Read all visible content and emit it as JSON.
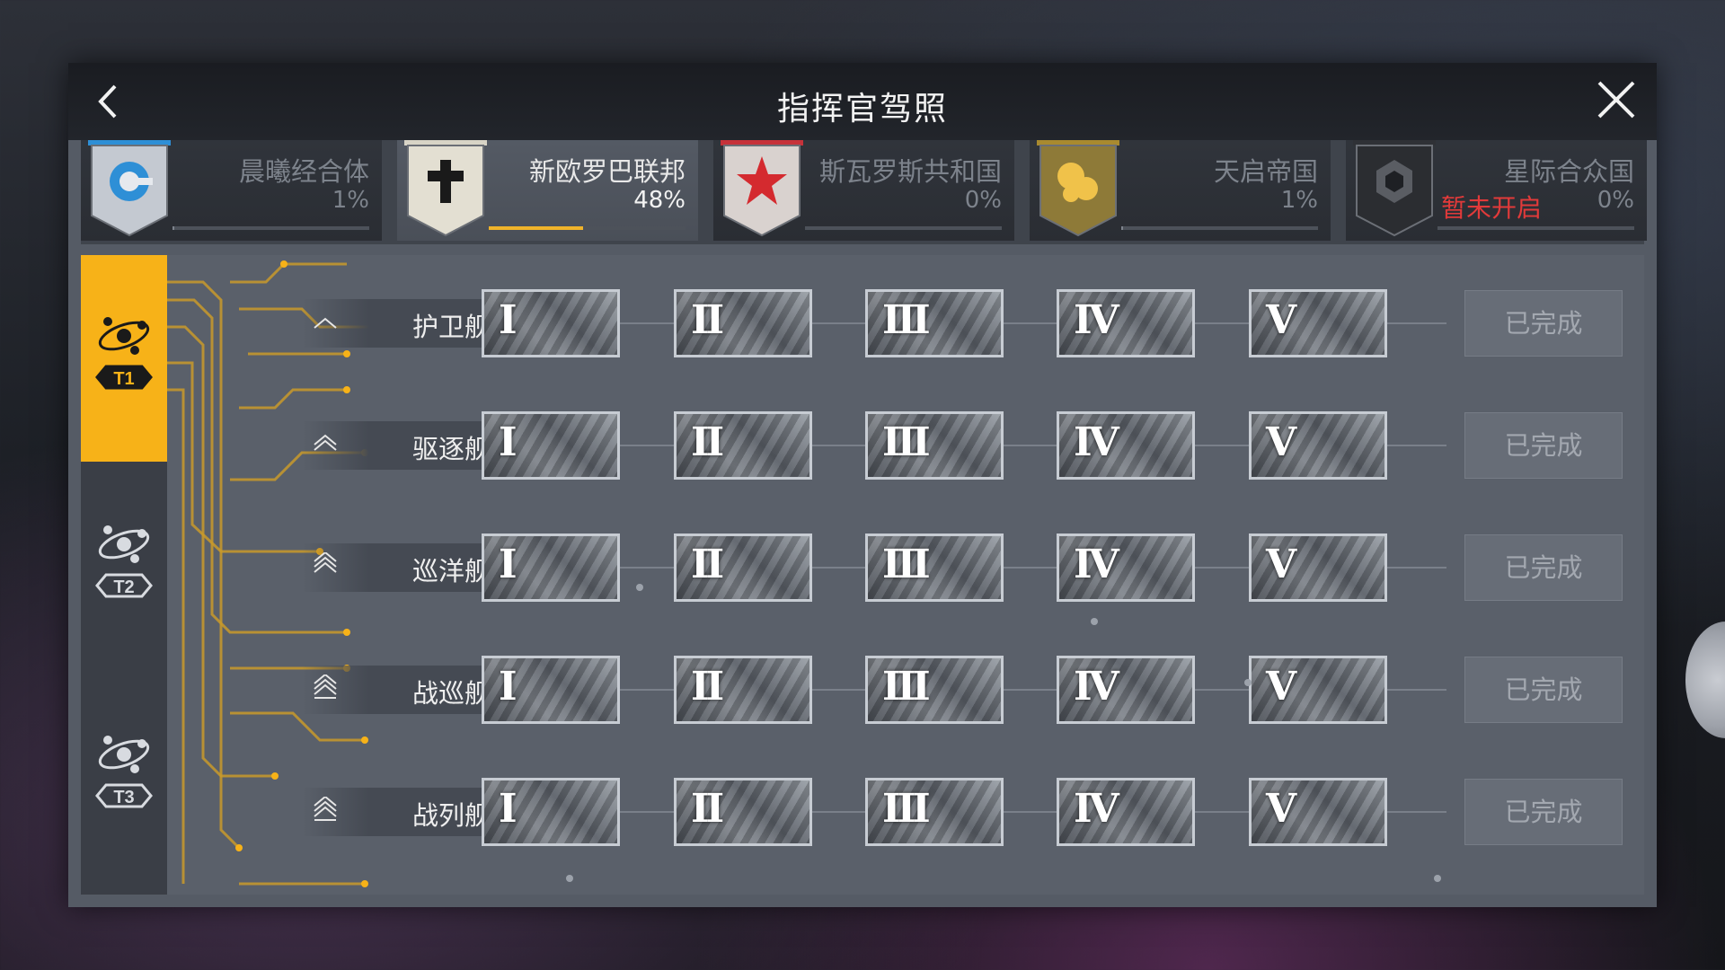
{
  "header": {
    "title": "指挥官驾照"
  },
  "factions": [
    {
      "name": "晨曦经合体",
      "percent": "1%",
      "progress": 0.01,
      "active": false,
      "locked_text": "",
      "color": "#2e8fd6",
      "icon": "ring-icon"
    },
    {
      "name": "新欧罗巴联邦",
      "percent": "48%",
      "progress": 0.48,
      "active": true,
      "locked_text": "",
      "color": "#d8d4c6",
      "icon": "cross-icon"
    },
    {
      "name": "斯瓦罗斯共和国",
      "percent": "0%",
      "progress": 0.0,
      "active": false,
      "locked_text": "",
      "color": "#c6323a",
      "icon": "star-icon"
    },
    {
      "name": "天启帝国",
      "percent": "1%",
      "progress": 0.01,
      "active": false,
      "locked_text": "",
      "color": "#a98a2f",
      "icon": "orbs-icon"
    },
    {
      "name": "星际合众国",
      "percent": "0%",
      "progress": 0.0,
      "active": false,
      "locked_text": "暂未开启",
      "color": "#2f3136",
      "icon": "hexagon-icon"
    }
  ],
  "tiers": [
    {
      "label": "T1",
      "active": true
    },
    {
      "label": "T2",
      "active": false
    },
    {
      "label": "T3",
      "active": false
    }
  ],
  "ship_rows": [
    {
      "name": "护卫舰",
      "levels": [
        "I",
        "II",
        "III",
        "IV",
        "V"
      ],
      "status": "已完成"
    },
    {
      "name": "驱逐舰",
      "levels": [
        "I",
        "II",
        "III",
        "IV",
        "V"
      ],
      "status": "已完成"
    },
    {
      "name": "巡洋舰",
      "levels": [
        "I",
        "II",
        "III",
        "IV",
        "V"
      ],
      "status": "已完成"
    },
    {
      "name": "战巡舰",
      "levels": [
        "I",
        "II",
        "III",
        "IV",
        "V"
      ],
      "status": "已完成"
    },
    {
      "name": "战列舰",
      "levels": [
        "I",
        "II",
        "III",
        "IV",
        "V"
      ],
      "status": "已完成"
    }
  ],
  "colors": {
    "accent": "#f7b218",
    "panel": "#555b65",
    "locked": "#e23a3a"
  }
}
